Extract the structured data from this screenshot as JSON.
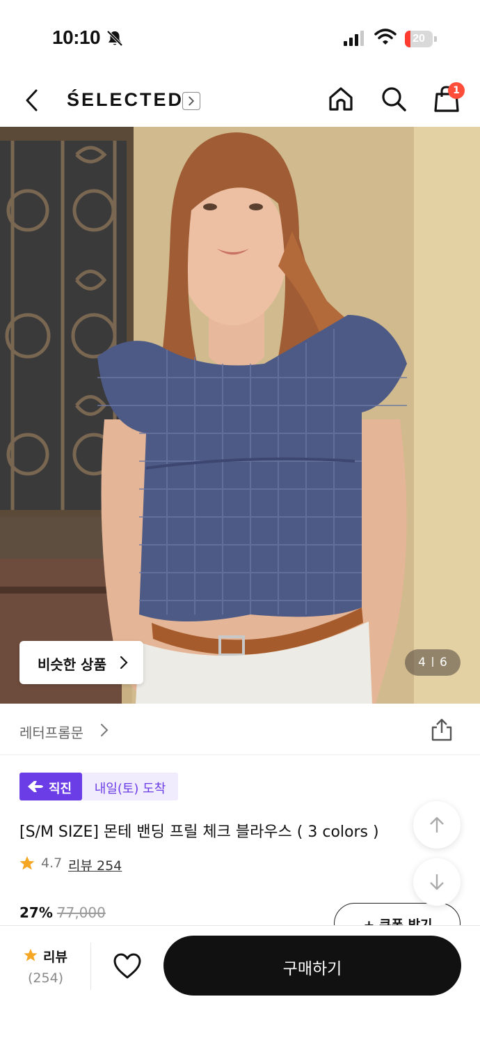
{
  "status_bar": {
    "time": "10:10",
    "battery": "20"
  },
  "header": {
    "brand": "ŚELECTED",
    "cart_count": "1"
  },
  "product_image": {
    "similar_label": "비슷한 상품",
    "current_index": "4",
    "total_images": "6"
  },
  "shop": {
    "name": "레터프롬문"
  },
  "badges": {
    "direct": "직진",
    "arrival": "내일(토) 도착"
  },
  "product": {
    "title": "[S/M SIZE] 몬테 밴딩 프릴 체크 블라우스 ( 3 colors )",
    "rating": "4.7",
    "review_link": "리뷰 254",
    "discount": "27%",
    "original_price": "77,000",
    "coupon_label": "+ 쿠폰 받기"
  },
  "bottom_bar": {
    "review_label": "리뷰",
    "review_count": "(254)",
    "buy_label": "구매하기"
  },
  "colors": {
    "accent": "#6b3de6",
    "accent_light": "#f0ebfd",
    "badge_red": "#ff4d3a",
    "star": "#f5a623",
    "buy_bg": "#111111"
  },
  "icons": [
    "bell-slash-icon",
    "signal-icon",
    "wifi-icon",
    "back-icon",
    "chevron-right-icon",
    "home-icon",
    "search-icon",
    "shopping-bag-icon",
    "share-icon",
    "plane-icon",
    "star-icon",
    "arrow-up-icon",
    "arrow-down-icon",
    "heart-icon"
  ]
}
